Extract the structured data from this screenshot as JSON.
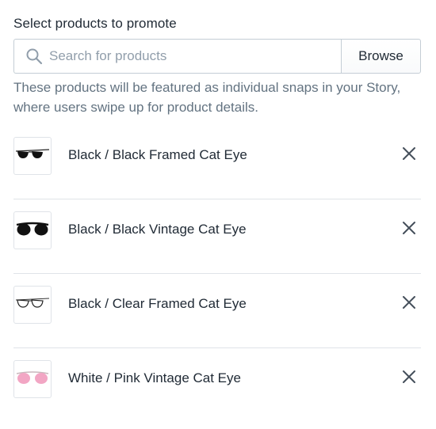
{
  "section": {
    "title": "Select products to promote"
  },
  "search": {
    "placeholder": "Search for products",
    "value": "",
    "browse_label": "Browse"
  },
  "help_text": "These products will be featured as individual snaps in your Story, where users swipe up for product details.",
  "products": [
    {
      "name": "Black / Black Framed Cat Eye",
      "thumbnail_icon": "black-framed-sunglasses-icon"
    },
    {
      "name": "Black / Black Vintage Cat Eye",
      "thumbnail_icon": "black-vintage-sunglasses-icon"
    },
    {
      "name": "Black / Clear Framed Cat Eye",
      "thumbnail_icon": "clear-framed-glasses-icon"
    },
    {
      "name": "White / Pink Vintage Cat Eye",
      "thumbnail_icon": "pink-vintage-sunglasses-icon"
    }
  ],
  "remove_icon": "close-icon",
  "colors": {
    "text": "#212b36",
    "muted": "#637381",
    "border": "#c4cdd5",
    "divider": "#dfe3e8",
    "placeholder": "#919eab"
  }
}
